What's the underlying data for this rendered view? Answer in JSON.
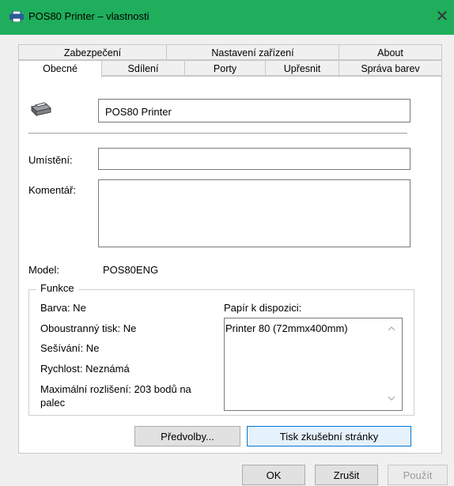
{
  "window": {
    "title": "POS80 Printer – vlastnosti",
    "close_glyph": "✕",
    "title_bar_color": "#1fae5c"
  },
  "tabs": {
    "top_row": [
      "Zabezpečení",
      "Nastavení zařízení",
      "About"
    ],
    "bottom_row": [
      "Obecné",
      "Sdílení",
      "Porty",
      "Upřesnit",
      "Správa barev"
    ],
    "active": "Obecné"
  },
  "general": {
    "printer_name": "POS80 Printer",
    "location_label": "Umístění:",
    "location_value": "",
    "comment_label": "Komentář:",
    "comment_value": "",
    "model_label": "Model:",
    "model_value": "POS80ENG"
  },
  "features": {
    "title": "Funkce",
    "color": "Barva: Ne",
    "duplex": "Oboustranný tisk: Ne",
    "staple": "Sešívání: Ne",
    "speed": "Rychlost: Neznámá",
    "resolution_line1": "Maximální rozlišení: 203 bodů na",
    "resolution_line2": "palec",
    "paper_label": "Papír k dispozici:",
    "paper_items": [
      "Printer 80 (72mmx400mm)"
    ]
  },
  "buttons": {
    "preferences": "Předvolby...",
    "test_page": "Tisk zkušební stránky",
    "ok": "OK",
    "cancel": "Zrušit",
    "apply": "Použít"
  }
}
